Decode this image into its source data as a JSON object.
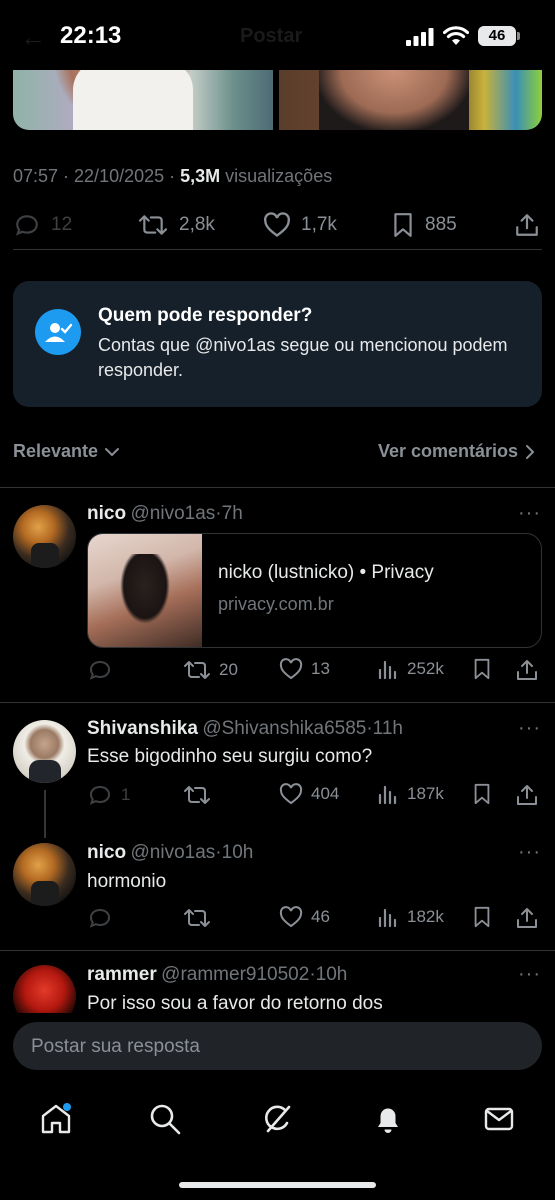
{
  "status_bar": {
    "time": "22:13",
    "battery": "46",
    "header_title": "Postar"
  },
  "post": {
    "timestamp": "07:57 · 22/10/2025 · ",
    "views_count": "5,3M",
    "views_label": " visualizações",
    "stats": {
      "replies": "12",
      "reposts": "2,8k",
      "likes": "1,7k",
      "bookmarks": "885"
    }
  },
  "reply_restriction": {
    "title": "Quem pode responder?",
    "description": "Contas que @nivo1as segue ou mencionou podem responder."
  },
  "sort": {
    "label": "Relevante",
    "view_comments": "Ver comentários"
  },
  "replies": [
    {
      "name": "nico",
      "handle": "@nivo1as",
      "time": "·7h",
      "link_card": {
        "title": "nicko (lustnicko) • Privacy",
        "domain": "privacy.com.br"
      },
      "stats": {
        "replies": "",
        "reposts": "20",
        "likes": "13",
        "views": "252k"
      }
    },
    {
      "name": "Shivanshika",
      "handle": "@Shivanshika6585",
      "time": "·11h",
      "text": "Esse bigodinho seu surgiu como?",
      "stats": {
        "replies": "1",
        "reposts": "",
        "likes": "404",
        "views": "187k"
      }
    },
    {
      "name": "nico",
      "handle": "@nivo1as",
      "time": "·10h",
      "text": "hormonio",
      "stats": {
        "replies": "",
        "reposts": "",
        "likes": "46",
        "views": "182k"
      }
    },
    {
      "name": "rammer",
      "handle": "@rammer910502",
      "time": "·10h",
      "text": "Por isso sou a favor do retorno dos"
    }
  ],
  "composer": {
    "placeholder": "Postar sua resposta"
  },
  "colors": {
    "accent": "#1d9bf0",
    "background": "#000000",
    "card": "#16202a"
  },
  "icons": [
    "home-icon",
    "search-icon",
    "grok-icon",
    "notifications-icon",
    "messages-icon"
  ]
}
